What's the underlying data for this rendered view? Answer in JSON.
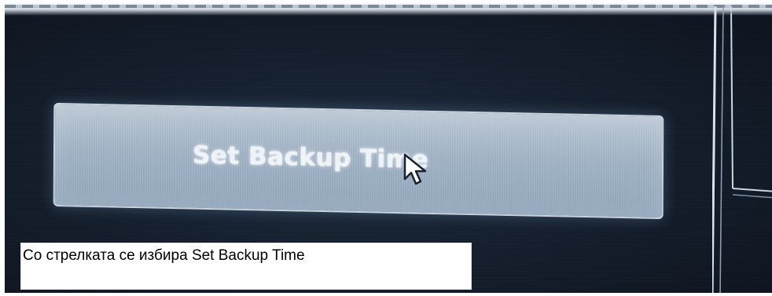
{
  "menu": {
    "button_label": "Set Backup Time"
  },
  "caption": {
    "text": "Со стрелката се избира Set Backup Time"
  },
  "icons": {
    "pointer": "mouse-cursor-icon"
  },
  "colors": {
    "screen_background": "#141e2c",
    "button_face": "#9eb0c2",
    "button_text": "#eef3f8",
    "caption_background": "#ffffff",
    "caption_text": "#000000"
  }
}
